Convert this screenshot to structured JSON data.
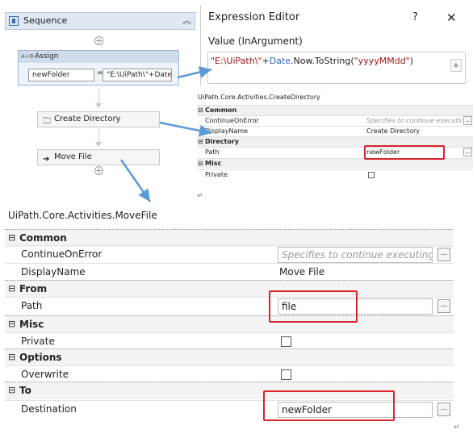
{
  "sequence": {
    "title": "Sequence",
    "collapse_glyph": "︽",
    "add_glyph": "+",
    "assign": {
      "badge": "A+B",
      "title": "Assign",
      "to_value": "newFolder",
      "equals": "=",
      "expression": "\"E:\\UiPath\\\"+Date"
    },
    "activities": [
      {
        "label": "Create Directory",
        "icon": "folder-icon"
      },
      {
        "label": "Move File",
        "icon": "arrow-right-icon"
      }
    ]
  },
  "expression_editor": {
    "title": "Expression Editor",
    "help": "?",
    "close": "✕",
    "value_label": "Value (InArgument)",
    "parts": {
      "str1": "\"E:\\UiPath\\\"",
      "op": "+",
      "kw": "Date",
      "call": ".Now.ToString(",
      "str2": "\"yyyyMMdd\"",
      "close": ")"
    },
    "scroll_glyph": "▲"
  },
  "small_props": {
    "type": "UiPath.Core.Activities.CreateDirectory",
    "collapse_glyph": "⊟",
    "categories": {
      "common": "Common",
      "directory": "Directory",
      "misc": "Misc"
    },
    "rows": {
      "continue_name": "ContinueOnError",
      "continue_placeholder": "Specifies to continue executing t",
      "display_name": "DisplayName",
      "display_value": "Create Directory",
      "path_name": "Path",
      "path_value": "newFolder",
      "private_name": "Private"
    },
    "dots": "..."
  },
  "large_props": {
    "type": "UiPath.Core.Activities.MoveFile",
    "collapse_glyph": "⊟",
    "categories": {
      "common": "Common",
      "from": "From",
      "misc": "Misc",
      "options": "Options",
      "to": "To"
    },
    "rows": {
      "continue_name": "ContinueOnError",
      "continue_placeholder": "Specifies to continue executing t",
      "display_name": "DisplayName",
      "display_value": "Move File",
      "path_name": "Path",
      "path_value": "file",
      "private_name": "Private",
      "overwrite_name": "Overwrite",
      "destination_name": "Destination",
      "destination_value": "newFolder"
    },
    "dots": "..."
  },
  "return_mark": "↵",
  "colors": {
    "highlight": "#d9242b",
    "arrow": "#5b9bd5",
    "keyword": "#2b5fc1",
    "string": "#a31515"
  }
}
